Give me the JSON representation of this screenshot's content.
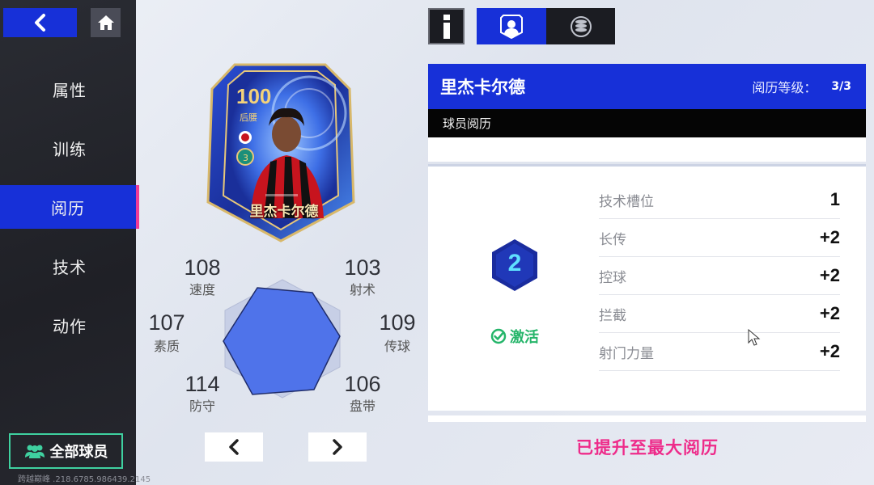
{
  "sidebar": {
    "back_icon": "chevron-left-icon",
    "home_icon": "home-icon",
    "items": [
      {
        "label": "属性"
      },
      {
        "label": "训练"
      },
      {
        "label": "阅历"
      },
      {
        "label": "技术"
      },
      {
        "label": "动作"
      }
    ],
    "active_index": 2,
    "all_players_label": "全部球员",
    "watermark": "跨越巅峰 .218.6785.986439.2145"
  },
  "card": {
    "rating": "100",
    "position": "后腰",
    "name": "里杰卡尔德"
  },
  "stats": {
    "speed": {
      "value": "108",
      "label": "速度"
    },
    "shooting": {
      "value": "103",
      "label": "射术"
    },
    "physical": {
      "value": "107",
      "label": "素质"
    },
    "passing": {
      "value": "109",
      "label": "传球"
    },
    "defense": {
      "value": "114",
      "label": "防守"
    },
    "dribbling": {
      "value": "106",
      "label": "盘带"
    }
  },
  "tabs": {
    "info_icon": "info-icon",
    "player_icon": "player-profile-icon",
    "coins_icon": "coin-stack-icon"
  },
  "panel": {
    "player_name": "里杰卡尔德",
    "level_label": "阅历等级：",
    "level_value": "3/3",
    "section_title": "球员阅历",
    "tier": "2",
    "activate_label": "激活",
    "attributes": [
      {
        "name": "技术槽位",
        "value": "1"
      },
      {
        "name": "长传",
        "value": "+2"
      },
      {
        "name": "控球",
        "value": "+2"
      },
      {
        "name": "拦截",
        "value": "+2"
      },
      {
        "name": "射门力量",
        "value": "+2"
      }
    ],
    "max_message": "已提升至最大阅历"
  },
  "colors": {
    "accent_blue": "#1730d8",
    "active_marker": "#f03c96",
    "success_green": "#25b56a",
    "max_pink": "#ee2b8a",
    "radar_fill": "#4f73ea"
  }
}
